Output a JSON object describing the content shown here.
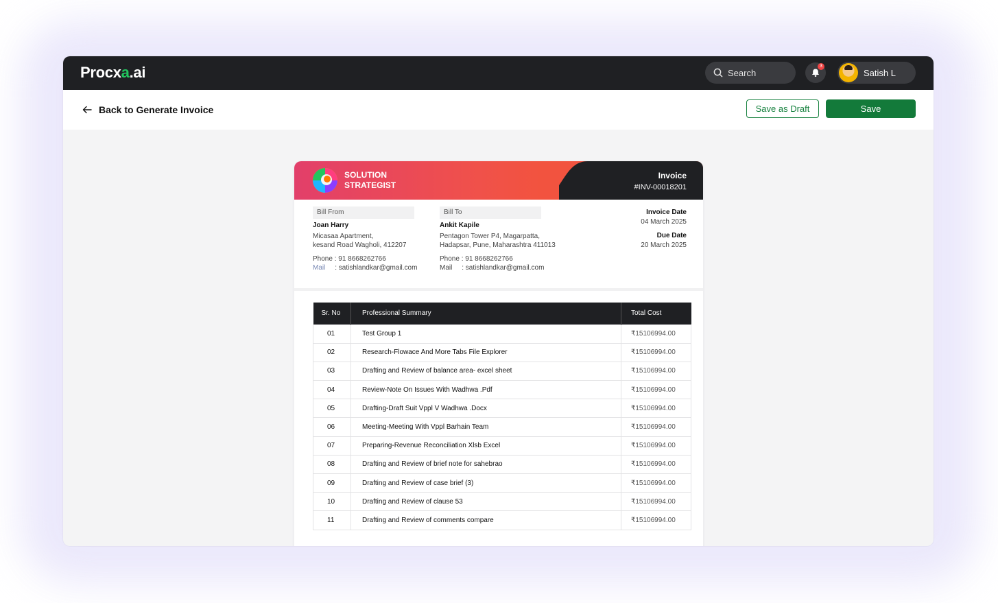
{
  "app": {
    "logo_prefix": "Procx",
    "logo_accent": "a",
    "logo_suffix": ".ai"
  },
  "topbar": {
    "search_label": "Search",
    "notification_count": "3",
    "user_name": "Satish L"
  },
  "subbar": {
    "back_label": "Back to Generate Invoice",
    "save_draft_label": "Save as Draft",
    "save_label": "Save"
  },
  "invoice": {
    "company_line1": "SOLUTION",
    "company_line2": "STRATEGIST",
    "title": "Invoice",
    "number": "#INV-00018201",
    "bill_from": {
      "label": "Bill From",
      "name": "Joan Harry",
      "address1": "Micasaa Apartment,",
      "address2": "kesand Road Wagholi, 412207",
      "phone": "Phone : 91 8668262766",
      "mail_key": "Mail",
      "mail_value": ": satishlandkar@gmail.com"
    },
    "bill_to": {
      "label": "Bill To",
      "name": "Ankit Kapile",
      "address1": "Pentagon Tower P4, Magarpatta,",
      "address2": "Hadapsar, Pune, Maharashtra 411013",
      "phone": "Phone : 91 8668262766",
      "mail_key": "Mail",
      "mail_value": ": satishlandkar@gmail.com"
    },
    "invoice_date_label": "Invoice Date",
    "invoice_date": "04 March 2025",
    "due_date_label": "Due Date",
    "due_date": "20 March 2025"
  },
  "table": {
    "headers": [
      "Sr. No",
      "Professional Summary",
      "Total Cost"
    ],
    "rows": [
      {
        "sr": "01",
        "summary": "Test Group 1",
        "cost": "₹15106994.00"
      },
      {
        "sr": "02",
        "summary": "Research-Flowace And More Tabs File Explorer",
        "cost": "₹15106994.00"
      },
      {
        "sr": "03",
        "summary": "Drafting and Review of balance area- excel sheet",
        "cost": "₹15106994.00"
      },
      {
        "sr": "04",
        "summary": "Review-Note On Issues With Wadhwa .Pdf",
        "cost": "₹15106994.00"
      },
      {
        "sr": "05",
        "summary": "Drafting-Draft Suit Vppl V Wadhwa .Docx",
        "cost": "₹15106994.00"
      },
      {
        "sr": "06",
        "summary": "Meeting-Meeting With Vppl Barhain Team",
        "cost": "₹15106994.00"
      },
      {
        "sr": "07",
        "summary": "Preparing-Revenue Reconciliation Xlsb Excel",
        "cost": "₹15106994.00"
      },
      {
        "sr": "08",
        "summary": "Drafting and Review of brief note for sahebrao",
        "cost": "₹15106994.00"
      },
      {
        "sr": "09",
        "summary": "Drafting and Review of case brief (3)",
        "cost": "₹15106994.00"
      },
      {
        "sr": "10",
        "summary": "Drafting and Review of clause 53",
        "cost": "₹15106994.00"
      },
      {
        "sr": "11",
        "summary": "Drafting and Review of comments compare",
        "cost": "₹15106994.00"
      }
    ]
  },
  "icons": {
    "search": "search-icon",
    "bell": "bell-icon",
    "back": "arrow-left-icon",
    "company_logo": "swirl-logo-icon"
  },
  "colors": {
    "topbar": "#1f2023",
    "primary_green": "#137a3a",
    "header_gradient_start": "#e23f6a",
    "header_gradient_end": "#f2533f"
  }
}
